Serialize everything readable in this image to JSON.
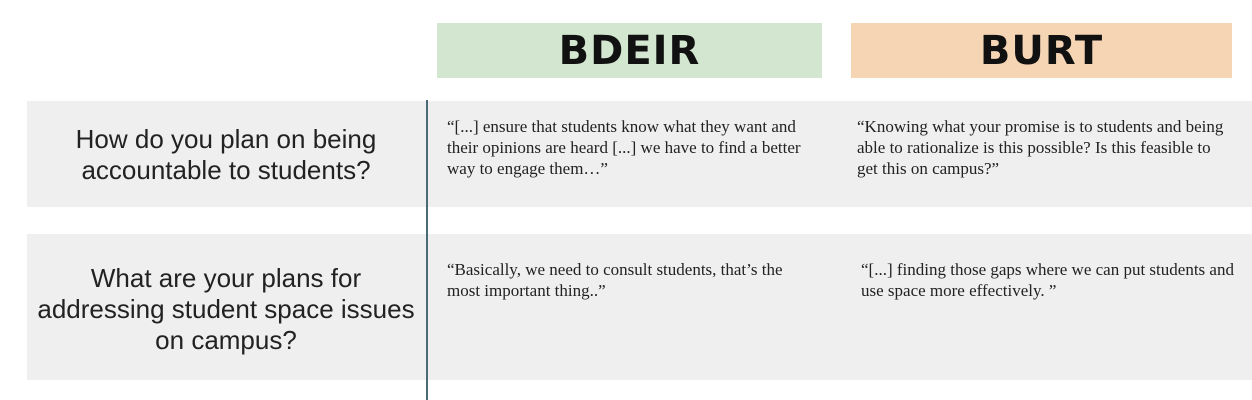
{
  "headers": {
    "bdeir": "BDEIR",
    "burt": "BURT"
  },
  "rows": [
    {
      "question": "How do you plan on being accountable to students?",
      "bdeir": "“[...] ensure that students know what they want and their opinions are heard [...] we have to find a better way to engage them…”",
      "burt": "“Knowing what your promise is to students and being able to rationalize is this possible? Is this feasible to get this on campus?”"
    },
    {
      "question": "What are your plans for addressing student space issues on campus?",
      "bdeir": "“Basically, we need to consult students, that’s the most important thing..”",
      "burt": "“[...] finding those gaps where we can put students and use space more effectively. ”"
    }
  ],
  "colors": {
    "bdeir_header": "#d3e6cf",
    "burt_header": "#f6d5b5",
    "row_background": "#efefef",
    "divider": "#4a6a78"
  }
}
